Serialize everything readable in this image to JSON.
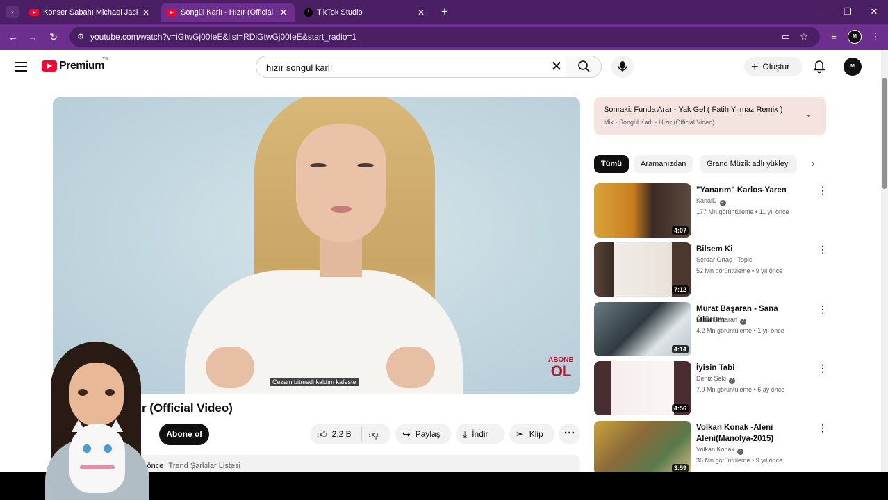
{
  "browser": {
    "tabs": [
      {
        "title": "Konser Sabahı Michael Jackson",
        "favicon": "youtube",
        "active": false
      },
      {
        "title": "Songül Karlı - Hızır (Official Vid",
        "favicon": "youtube",
        "active": true
      },
      {
        "title": "TikTok Studio",
        "favicon": "tiktok",
        "active": false
      }
    ],
    "tab_close": "✕",
    "new_tab": "+",
    "window": {
      "minimize": "—",
      "restore": "❐",
      "close": "✕"
    },
    "url_host": "youtube.com",
    "url_path": "/watch?v=iGtwGj00IeE&list=RDiGtwGj00IeE&start_radio=1",
    "profile_label": "M"
  },
  "header": {
    "logo_text": "Premium",
    "logo_region": "TR",
    "search_value": "hızır songül karlı",
    "search_clear": "✕",
    "create_label": "Oluştur",
    "create_plus": "+",
    "avatar_label": "M"
  },
  "player": {
    "subtitle": "Cezam bitmedi kaldım kafeste",
    "watermark_line1": "ABONE",
    "watermark_line2": "OL"
  },
  "video": {
    "title_visible": "ızır (Official Video)",
    "subscribe_label": "Abone ol",
    "likes": "2,2 B",
    "share_label": "Paylaş",
    "download_label": "İndir",
    "clip_label": "Klip",
    "more_label": "⋯",
    "desc_time": "l önce",
    "desc_tag": "Trend Şarkılar Listesi"
  },
  "upnext": {
    "prefix": "Sonraki:",
    "title": "Funda Arar - Yak Gel ( Fatih Yılmaz Remix )",
    "mix": "Mix - Songül Karlı - Hızır (Official Video)",
    "chevron": "⌄"
  },
  "chips": [
    "Tümü",
    "Aramanızdan",
    "Grand Müzik adlı yükleyi"
  ],
  "chip_next": "›",
  "recommendations": [
    {
      "title": "\"Yanarım\" Karlos-Yaren",
      "channel": "KanalD",
      "verified": true,
      "meta": "177 Mn görüntüleme • 11 yıl önce",
      "duration": "4:07"
    },
    {
      "title": "Bilsem Ki",
      "channel": "Serdar Ortaç - Topic",
      "verified": false,
      "meta": "52 Mn görüntüleme • 9 yıl önce",
      "duration": "7:12"
    },
    {
      "title": "Murat Başaran - Sana Ölürüm",
      "channel": "Murat Başaran",
      "verified": true,
      "meta": "4,2 Mn görüntüleme • 1 yıl önce",
      "duration": "4:14"
    },
    {
      "title": "İyisin Tabi",
      "channel": "Deniz Seki",
      "verified": true,
      "meta": "7,9 Mn görüntüleme • 6 ay önce",
      "duration": "4:56"
    },
    {
      "title": "Volkan Konak -Aleni Aleni(Manolya-2015)",
      "channel": "Volkan Konak",
      "verified": true,
      "meta": "36 Mn görüntüleme • 9 yıl önce",
      "duration": "3:59"
    }
  ],
  "verified_mark": "✓",
  "kebab": "⋮",
  "colors": {
    "chrome_tabbar": "#4a1f63",
    "chrome_toolbar": "#6d2f8e",
    "youtube_red": "#ff0033",
    "upnext_bg": "#f5e3e0"
  }
}
